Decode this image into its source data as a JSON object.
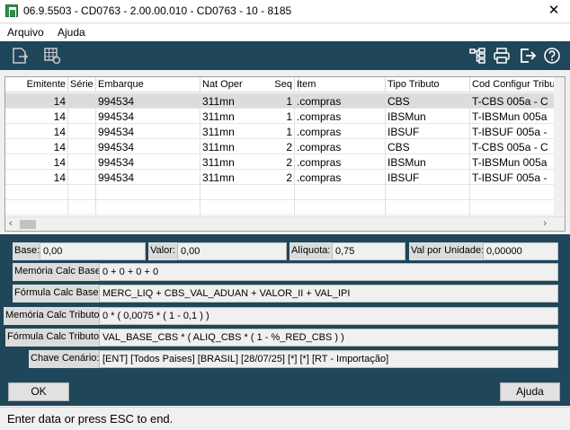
{
  "window": {
    "title": "06.9.5503 - CD0763 - 2.00.00.010 - CD0763 - 10 - 8185",
    "close_icon": "close-icon"
  },
  "menu": {
    "items": [
      {
        "label": "Arquivo"
      },
      {
        "label": "Ajuda"
      }
    ]
  },
  "toolbar": {
    "icons_left": [
      "document-export-icon",
      "grid-settings-icon"
    ],
    "icons_right": [
      "tree-structure-icon",
      "print-icon",
      "exit-icon",
      "help-icon"
    ]
  },
  "grid": {
    "columns": [
      "Emitente",
      "Série",
      "Embarque",
      "Nat Oper",
      "Seq",
      "Item",
      "Tipo Tributo",
      "Cod Configur Tribu"
    ],
    "rows": [
      [
        "14",
        "",
        "994534",
        "311mn",
        "1",
        ".compras",
        "CBS",
        "T-CBS 005a - C"
      ],
      [
        "14",
        "",
        "994534",
        "311mn",
        "1",
        ".compras",
        "IBSMun",
        "T-IBSMun 005a"
      ],
      [
        "14",
        "",
        "994534",
        "311mn",
        "1",
        ".compras",
        "IBSUF",
        "T-IBSUF 005a -"
      ],
      [
        "14",
        "",
        "994534",
        "311mn",
        "2",
        ".compras",
        "CBS",
        "T-CBS 005a - C"
      ],
      [
        "14",
        "",
        "994534",
        "311mn",
        "2",
        ".compras",
        "IBSMun",
        "T-IBSMun 005a"
      ],
      [
        "14",
        "",
        "994534",
        "311mn",
        "2",
        ".compras",
        "IBSUF",
        "T-IBSUF 005a -"
      ]
    ],
    "scroll_left_icon": "chevron-left-icon",
    "scroll_right_icon": "chevron-right-icon"
  },
  "form": {
    "base_label": "Base:",
    "base_value": "0,00",
    "valor_label": "Valor:",
    "valor_value": "0,00",
    "aliquota_label": "Alíquota:",
    "aliquota_value": "0,75",
    "val_unidade_label": "Val por Unidade:",
    "val_unidade_value": "0,00000",
    "memoria_base_label": "Memória Calc Base:",
    "memoria_base_value": "0 + 0 + 0 + 0",
    "formula_base_label": "Fórmula Calc Base:",
    "formula_base_value": "MERC_LIQ + CBS_VAL_ADUAN + VALOR_II + VAL_IPI",
    "memoria_tributo_label": "Memória Calc Tributo:",
    "memoria_tributo_value": "0 * ( 0,0075 * ( 1 - 0,1 ) )",
    "formula_tributo_label": "Fórmula Calc Tributo:",
    "formula_tributo_value": "VAL_BASE_CBS * ( ALIQ_CBS * ( 1 - %_RED_CBS ) )",
    "chave_label": "Chave Cenário:",
    "chave_value": "[ENT] [Todos Paises] [BRASIL] [28/07/25] [*] [*] [RT - Importação]"
  },
  "buttons": {
    "ok": "OK",
    "ajuda": "Ajuda"
  },
  "status": "Enter data or press ESC to end."
}
